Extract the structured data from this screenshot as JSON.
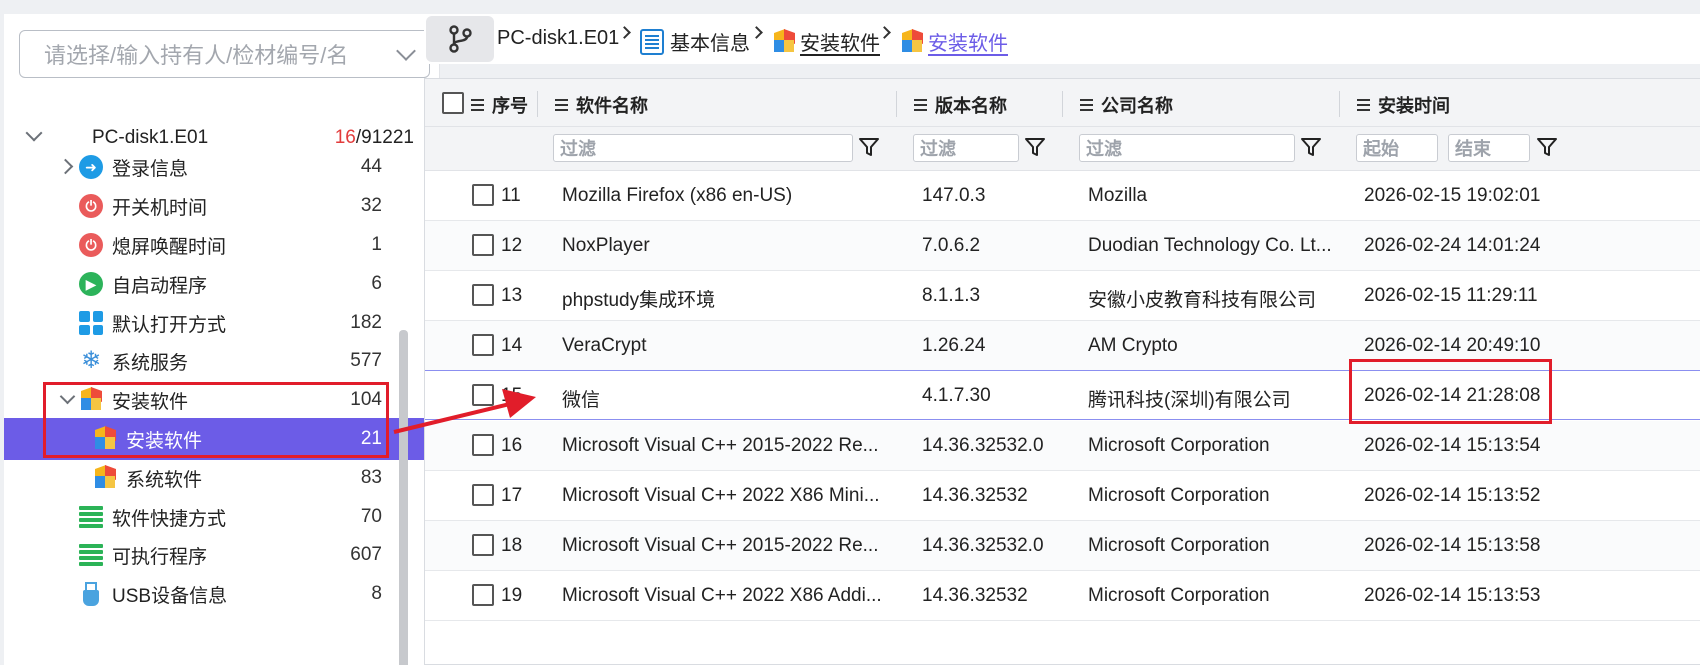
{
  "left": {
    "filter_placeholder": "请选择/输入持有人/检材编号/名",
    "root": {
      "label": "PC-disk1.E01",
      "count_highlight": "16",
      "count_rest": "/91221"
    },
    "items": [
      {
        "label": "登录信息",
        "count": "44"
      },
      {
        "label": "开关机时间",
        "count": "32"
      },
      {
        "label": "熄屏唤醒时间",
        "count": "1"
      },
      {
        "label": "自启动程序",
        "count": "6"
      },
      {
        "label": "默认打开方式",
        "count": "182"
      },
      {
        "label": "系统服务",
        "count": "577"
      },
      {
        "label": "安装软件",
        "count": "104"
      },
      {
        "label": "安装软件",
        "count": "21"
      },
      {
        "label": "系统软件",
        "count": "83"
      },
      {
        "label": "软件快捷方式",
        "count": "70"
      },
      {
        "label": "可执行程序",
        "count": "607"
      },
      {
        "label": "USB设备信息",
        "count": "8"
      }
    ]
  },
  "breadcrumb": {
    "root": "PC-disk1.E01",
    "b1": "基本信息",
    "b2": "安装软件",
    "b3": "安装软件"
  },
  "table": {
    "headers": {
      "seq": "序号",
      "name": "软件名称",
      "version": "版本名称",
      "company": "公司名称",
      "time": "安装时间"
    },
    "filters": {
      "placeholder": "过滤",
      "start": "起始",
      "end": "结束"
    },
    "rows": [
      {
        "seq": "11",
        "name": "Mozilla Firefox (x86 en-US)",
        "version": "147.0.3",
        "company": "Mozilla",
        "time": "2026-02-15 19:02:01"
      },
      {
        "seq": "12",
        "name": "NoxPlayer",
        "version": "7.0.6.2",
        "company": "Duodian Technology Co. Lt...",
        "time": "2026-02-24 14:01:24"
      },
      {
        "seq": "13",
        "name": "phpstudy集成环境",
        "version": "8.1.1.3",
        "company": "安徽小皮教育科技有限公司",
        "time": "2026-02-15 11:29:11"
      },
      {
        "seq": "14",
        "name": "VeraCrypt",
        "version": "1.26.24",
        "company": "AM Crypto",
        "time": "2026-02-14 20:49:10"
      },
      {
        "seq": "15",
        "name": "微信",
        "version": "4.1.7.30",
        "company": "腾讯科技(深圳)有限公司",
        "time": "2026-02-14 21:28:08"
      },
      {
        "seq": "16",
        "name": "Microsoft Visual C++ 2015-2022 Re...",
        "version": "14.36.32532.0",
        "company": "Microsoft Corporation",
        "time": "2026-02-14 15:13:54"
      },
      {
        "seq": "17",
        "name": "Microsoft Visual C++ 2022 X86 Mini...",
        "version": "14.36.32532",
        "company": "Microsoft Corporation",
        "time": "2026-02-14 15:13:52"
      },
      {
        "seq": "18",
        "name": "Microsoft Visual C++ 2015-2022 Re...",
        "version": "14.36.32532.0",
        "company": "Microsoft Corporation",
        "time": "2026-02-14 15:13:58"
      },
      {
        "seq": "19",
        "name": "Microsoft Visual C++ 2022 X86 Addi...",
        "version": "14.36.32532",
        "company": "Microsoft Corporation",
        "time": "2026-02-14 15:13:53"
      }
    ]
  },
  "colors": {
    "accent": "#6c5ce7",
    "annotation": "#e11d2a"
  }
}
